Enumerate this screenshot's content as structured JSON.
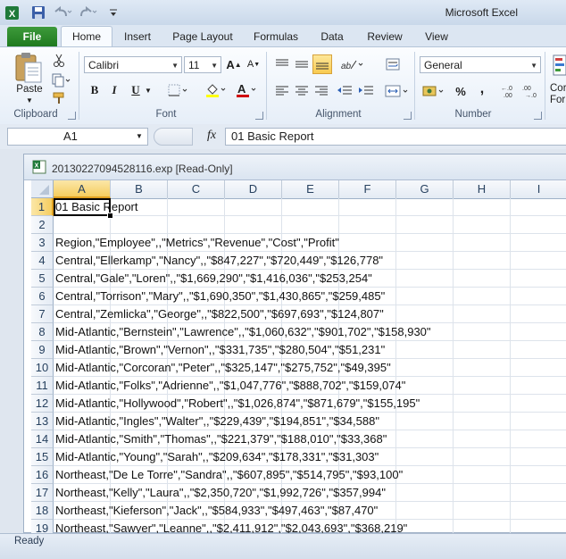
{
  "app": {
    "title": "Microsoft Excel"
  },
  "tabs": [
    "File",
    "Home",
    "Insert",
    "Page Layout",
    "Formulas",
    "Data",
    "Review",
    "View"
  ],
  "ribbon": {
    "clipboard": {
      "paste_label": "Paste",
      "group_label": "Clipboard"
    },
    "font": {
      "name": "Calibri",
      "size": "11",
      "group_label": "Font",
      "bold": "B",
      "italic": "I",
      "underline": "U"
    },
    "alignment": {
      "group_label": "Alignment"
    },
    "number": {
      "format": "General",
      "group_label": "Number",
      "percent": "%",
      "comma": ","
    },
    "styles": {
      "label_line1": "Cor",
      "label_line2": "For"
    }
  },
  "formula_bar": {
    "name_box": "A1",
    "fx": "fx",
    "content": "01 Basic Report"
  },
  "workbook": {
    "title": "20130227094528116.exp  [Read-Only]"
  },
  "grid": {
    "columns": [
      "A",
      "B",
      "C",
      "D",
      "E",
      "F",
      "G",
      "H",
      "I"
    ],
    "rows": [
      "01 Basic Report",
      "",
      "Region,\"Employee\",,\"Metrics\",\"Revenue\",\"Cost\",\"Profit\"",
      "Central,\"Ellerkamp\",\"Nancy\",,\"$847,227\",\"$720,449\",\"$126,778\"",
      "Central,\"Gale\",\"Loren\",,\"$1,669,290\",\"$1,416,036\",\"$253,254\"",
      "Central,\"Torrison\",\"Mary\",,\"$1,690,350\",\"$1,430,865\",\"$259,485\"",
      "Central,\"Zemlicka\",\"George\",,\"$822,500\",\"$697,693\",\"$124,807\"",
      "Mid-Atlantic,\"Bernstein\",\"Lawrence\",,\"$1,060,632\",\"$901,702\",\"$158,930\"",
      "Mid-Atlantic,\"Brown\",\"Vernon\",,\"$331,735\",\"$280,504\",\"$51,231\"",
      "Mid-Atlantic,\"Corcoran\",\"Peter\",,\"$325,147\",\"$275,752\",\"$49,395\"",
      "Mid-Atlantic,\"Folks\",\"Adrienne\",,\"$1,047,776\",\"$888,702\",\"$159,074\"",
      "Mid-Atlantic,\"Hollywood\",\"Robert\",,\"$1,026,874\",\"$871,679\",\"$155,195\"",
      "Mid-Atlantic,\"Ingles\",\"Walter\",,\"$229,439\",\"$194,851\",\"$34,588\"",
      "Mid-Atlantic,\"Smith\",\"Thomas\",,\"$221,379\",\"$188,010\",\"$33,368\"",
      "Mid-Atlantic,\"Young\",\"Sarah\",,\"$209,634\",\"$178,331\",\"$31,303\"",
      "Northeast,\"De Le Torre\",\"Sandra\",,\"$607,895\",\"$514,795\",\"$93,100\"",
      "Northeast,\"Kelly\",\"Laura\",,\"$2,350,720\",\"$1,992,726\",\"$357,994\"",
      "Northeast,\"Kieferson\",\"Jack\",,\"$584,933\",\"$497,463\",\"$87,470\"",
      "Northeast,\"Sawyer\",\"Leanne\",,\"$2,411,912\",\"$2,043,693\",\"$368,219\""
    ]
  },
  "status": {
    "text": "Ready"
  },
  "colors": {
    "file_tab": "#2a8a2a",
    "selection": "#000000",
    "ribbon_bg": "#f3f7fc"
  }
}
